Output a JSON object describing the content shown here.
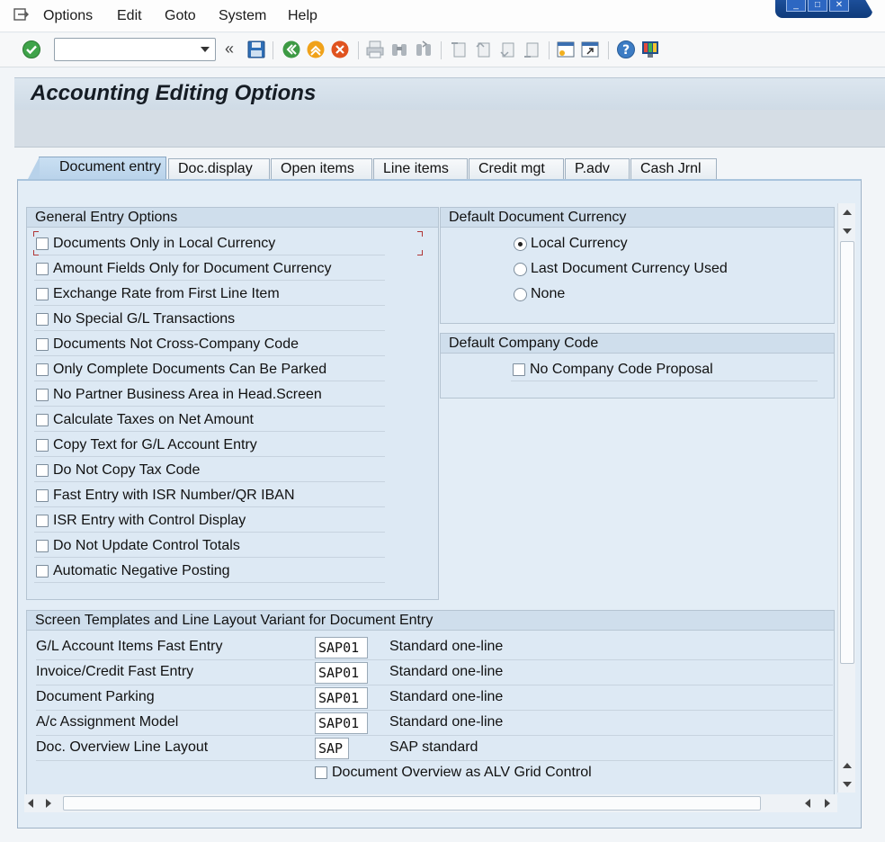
{
  "menu": {
    "items": [
      {
        "label": "Options"
      },
      {
        "label": "Edit"
      },
      {
        "label": "Goto"
      },
      {
        "label": "System"
      },
      {
        "label": "Help"
      }
    ]
  },
  "toolbar": {
    "command_value": "",
    "icons": [
      "enter-check-icon",
      "save-icon",
      "back-icon",
      "exit-icon",
      "cancel-icon",
      "print-icon",
      "find-icon",
      "find-next-icon",
      "first-page-icon",
      "previous-page-icon",
      "next-page-icon",
      "last-page-icon",
      "create-session-icon",
      "shortcut-icon",
      "help-icon",
      "customize-layout-icon"
    ]
  },
  "title": "Accounting Editing Options",
  "tabs": [
    {
      "label": "Document entry",
      "active": true
    },
    {
      "label": "Doc.display"
    },
    {
      "label": "Open items"
    },
    {
      "label": "Line items"
    },
    {
      "label": "Credit mgt"
    },
    {
      "label": "P.adv"
    },
    {
      "label": "Cash Jrnl"
    }
  ],
  "general_entry": {
    "title": "General Entry Options",
    "options": [
      {
        "label": "Documents Only in Local Currency",
        "checked": false
      },
      {
        "label": "Amount Fields Only for Document Currency",
        "checked": false
      },
      {
        "label": "Exchange Rate from First Line Item",
        "checked": false
      },
      {
        "label": "No Special G/L Transactions",
        "checked": false
      },
      {
        "label": "Documents Not Cross-Company Code",
        "checked": false
      },
      {
        "label": "Only Complete Documents Can Be Parked",
        "checked": false
      },
      {
        "label": "No Partner Business Area in Head.Screen",
        "checked": false
      },
      {
        "label": "Calculate Taxes on Net Amount",
        "checked": false
      },
      {
        "label": "Copy Text for G/L Account Entry",
        "checked": false
      },
      {
        "label": "Do Not Copy Tax Code",
        "checked": false
      },
      {
        "label": "Fast Entry with ISR Number/QR IBAN",
        "checked": false
      },
      {
        "label": "ISR Entry with Control Display",
        "checked": false
      },
      {
        "label": "Do Not Update Control Totals",
        "checked": false
      },
      {
        "label": "Automatic Negative Posting",
        "checked": false
      }
    ]
  },
  "default_currency": {
    "title": "Default Document Currency",
    "options": [
      {
        "label": "Local Currency",
        "selected": true
      },
      {
        "label": "Last Document Currency Used",
        "selected": false
      },
      {
        "label": "None",
        "selected": false
      }
    ]
  },
  "default_company": {
    "title": "Default Company Code",
    "option": {
      "label": "No Company Code Proposal",
      "checked": false
    }
  },
  "templates": {
    "title": "Screen Templates and Line Layout Variant for Document Entry",
    "rows": [
      {
        "label": "G/L Account Items Fast Entry",
        "value": "SAP01",
        "desc": "Standard one-line"
      },
      {
        "label": "Invoice/Credit Fast Entry",
        "value": "SAP01",
        "desc": "Standard one-line"
      },
      {
        "label": "Document Parking",
        "value": "SAP01",
        "desc": "Standard one-line"
      },
      {
        "label": "A/c Assignment Model",
        "value": "SAP01",
        "desc": "Standard one-line"
      },
      {
        "label": "Doc. Overview Line Layout",
        "value": "SAP",
        "desc": "SAP standard"
      }
    ],
    "alv_option": {
      "label": "Document Overview as ALV Grid Control",
      "checked": false
    }
  },
  "colors": {
    "panel_bg": "#e3edf6",
    "group_header": "#cfdeec",
    "title_bg": "#d5dde5",
    "active_tab": "#b8d2ea",
    "focus_marker": "#b03535"
  }
}
